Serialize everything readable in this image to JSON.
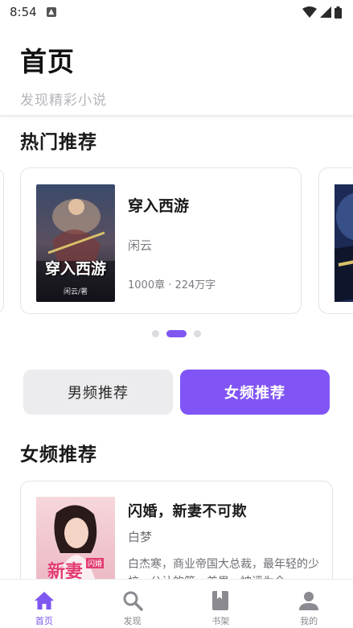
{
  "status_bar": {
    "time": "8:54"
  },
  "header": {
    "title": "首页",
    "subtitle": "发现精彩小说"
  },
  "hot": {
    "section_title": "热门推荐",
    "featured": {
      "title": "穿入西游",
      "author": "闲云",
      "meta": "1000章 · 224万字",
      "cover_text": "穿入西游",
      "cover_author": "闲云/著"
    },
    "carousel_total": 3,
    "carousel_active": 2
  },
  "toggle": {
    "male_label": "男频推荐",
    "female_label": "女频推荐"
  },
  "female": {
    "section_title": "女频推荐",
    "items": [
      {
        "title": "闪婚，新妻不可欺",
        "author": "白梦",
        "desc": "白杰寒，商业帝国大总裁，最年轻的少校，公认的第一美男，被评为全…",
        "cover_text": "新妻",
        "cover_badge": "闪婚"
      }
    ]
  },
  "nav": {
    "items": [
      {
        "label": "首页"
      },
      {
        "label": "发现"
      },
      {
        "label": "书架"
      },
      {
        "label": "我的"
      }
    ]
  },
  "colors": {
    "accent": "#8155f5",
    "muted": "#b5b5bb"
  }
}
